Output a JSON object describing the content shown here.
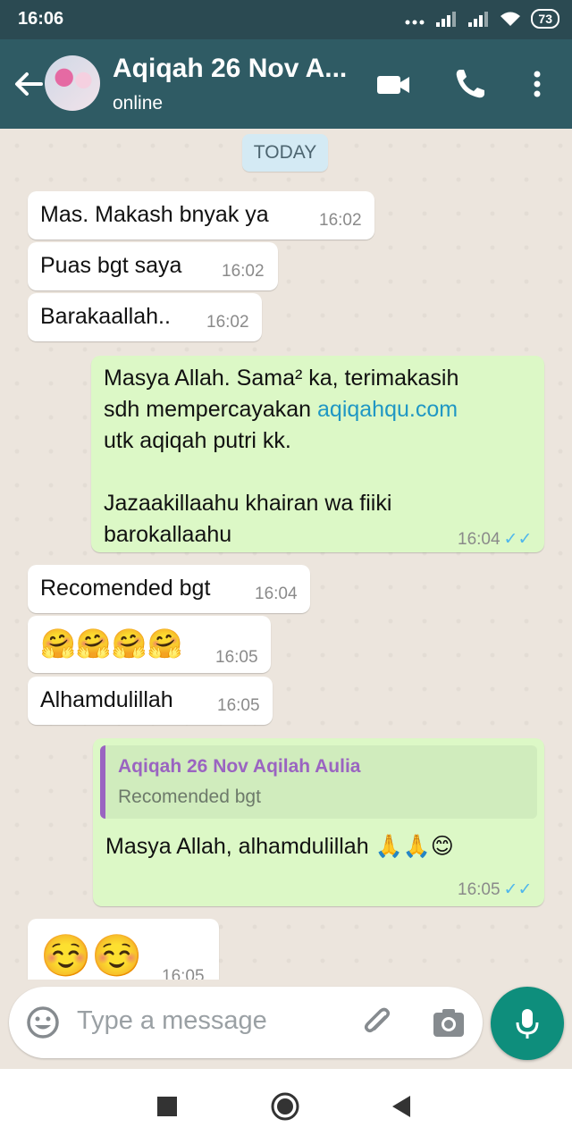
{
  "status_bar": {
    "time": "16:06",
    "battery": "73"
  },
  "header": {
    "title": "Aqiqah 26 Nov A...",
    "subtitle": "online"
  },
  "chat": {
    "date_divider": "TODAY",
    "messages": [
      {
        "dir": "in",
        "text": "Mas. Makash bnyak ya",
        "time": "16:02"
      },
      {
        "dir": "in",
        "text": "Puas bgt saya",
        "time": "16:02"
      },
      {
        "dir": "in",
        "text": "Barakaallah..",
        "time": "16:02"
      },
      {
        "dir": "out",
        "line1": "Masya Allah. Sama² ka, terimakasih",
        "line2_prefix": "sdh mempercayakan ",
        "link": "aqiqahqu.com",
        "line3": "utk aqiqah putri kk.",
        "line4": "Jazaakillaahu khairan wa fiiki",
        "line5": "barokallaahu",
        "time": "16:04",
        "ticks": "✓✓"
      },
      {
        "dir": "in",
        "text": "Recomended bgt",
        "time": "16:04"
      },
      {
        "dir": "in",
        "text": "🤗🤗🤗🤗",
        "time": "16:05"
      },
      {
        "dir": "in",
        "text": "Alhamdulillah",
        "time": "16:05"
      },
      {
        "dir": "out",
        "quote_author": "Aqiqah 26 Nov Aqilah Aulia",
        "quote_text": "Recomended bgt",
        "text": "Masya Allah, alhamdulillah 🙏🙏😊",
        "time": "16:05",
        "ticks": "✓✓"
      },
      {
        "dir": "in",
        "text": "☺️☺️",
        "time": "16:05"
      }
    ]
  },
  "composer": {
    "placeholder": "Type a message"
  },
  "icons": [
    "back-arrow-icon",
    "video-call-icon",
    "phone-icon",
    "more-vert-icon",
    "emoji-icon",
    "attach-icon",
    "camera-icon",
    "mic-icon",
    "nav-recents-icon",
    "nav-home-icon",
    "nav-back-icon"
  ],
  "colors": {
    "appbar": "#2f5b64",
    "outgoing": "#dcf8c6",
    "incoming": "#ffffff",
    "accent": "#0e8e7c",
    "read_ticks": "#4fb6ec"
  }
}
